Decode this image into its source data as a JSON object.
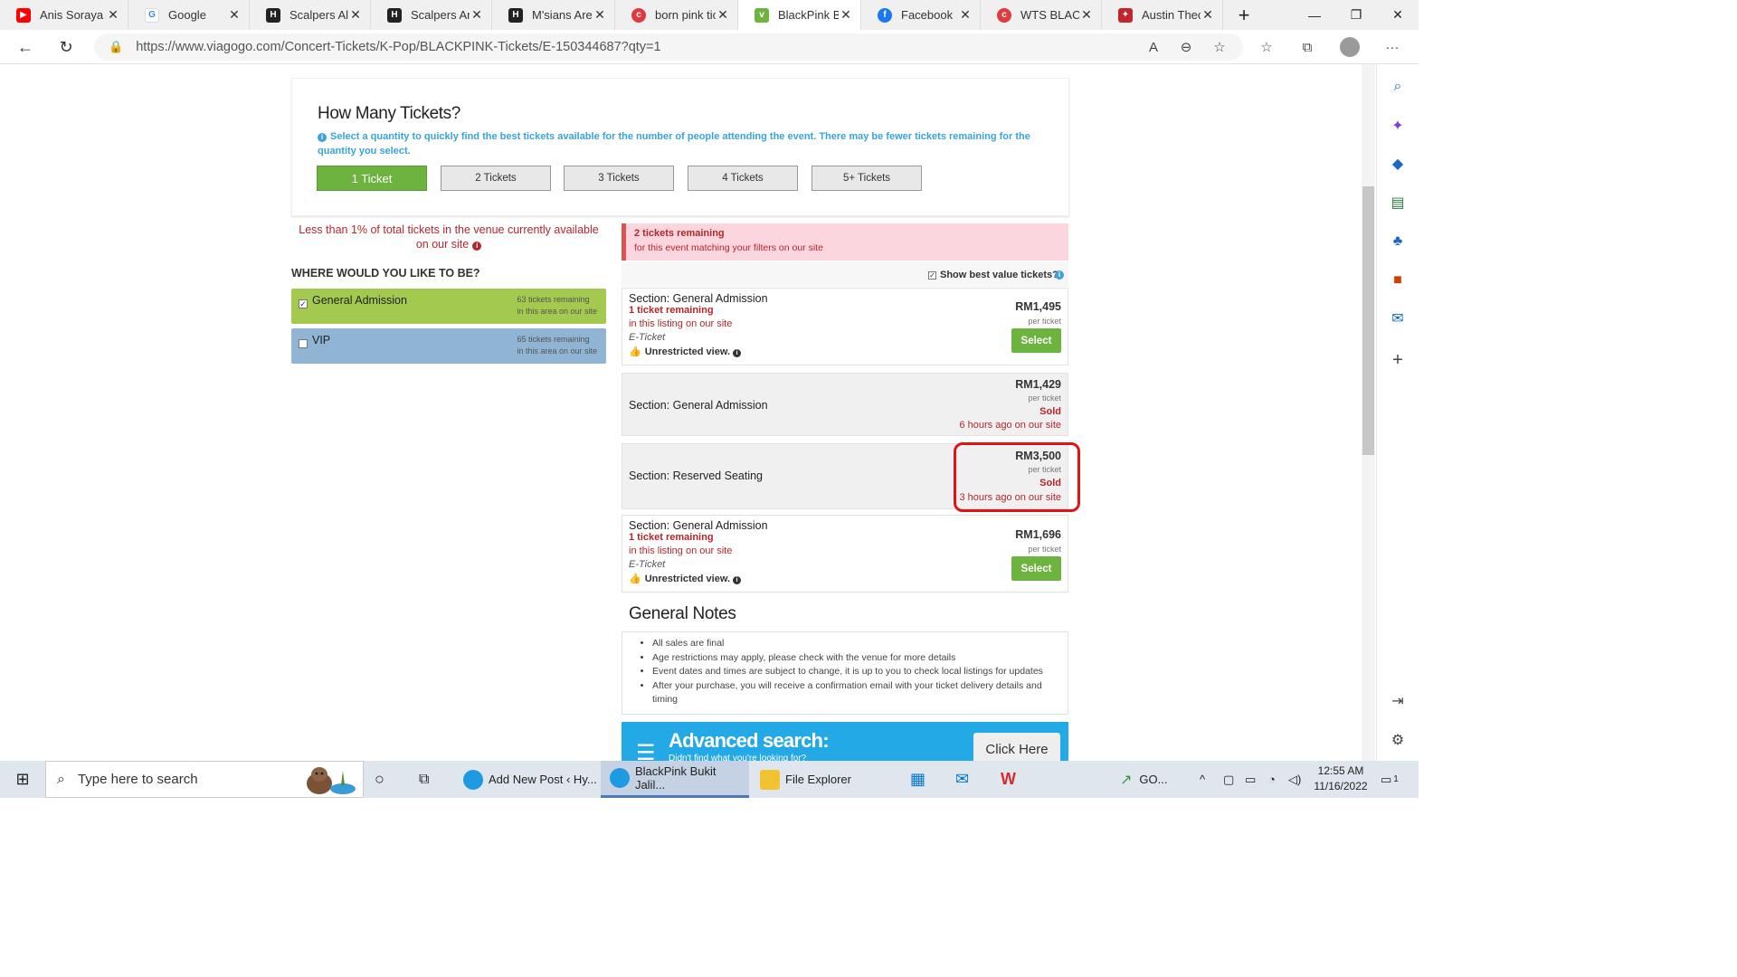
{
  "browser": {
    "tabs": [
      {
        "label": "Anis Soraya",
        "favicon": "youtube-icon",
        "color": "#ff0000"
      },
      {
        "label": "Google",
        "favicon": "google-icon",
        "color": "#4285f4"
      },
      {
        "label": "Scalpers Alre",
        "favicon": "hype-icon",
        "color": "#222222"
      },
      {
        "label": "Scalpers Are",
        "favicon": "hype-icon",
        "color": "#222222"
      },
      {
        "label": "M'sians Are",
        "favicon": "hype-icon",
        "color": "#222222"
      },
      {
        "label": "born pink tic",
        "favicon": "carousell-icon",
        "color": "#e0393e"
      },
      {
        "label": "BlackPink Bu",
        "favicon": "viagogo-icon",
        "color": "#6db33f"
      },
      {
        "label": "Facebook",
        "favicon": "facebook-icon",
        "color": "#1877f2"
      },
      {
        "label": "WTS BLACKP",
        "favicon": "carousell-icon",
        "color": "#e0393e"
      },
      {
        "label": "Austin Theo",
        "favicon": "bird-icon",
        "color": "#c0272d"
      }
    ],
    "url": "https://www.viagogo.com/Concert-Tickets/K-Pop/BLACKPINK-Tickets/E-150344687?qty=1"
  },
  "quantity": {
    "title": "How Many Tickets?",
    "hint": "Select a quantity to quickly find the best tickets available for the number of people attending the event. There may be fewer tickets remaining for the quantity you select.",
    "options": [
      "1 Ticket",
      "2 Tickets",
      "3 Tickets",
      "4 Tickets",
      "5+ Tickets"
    ],
    "selected": "1 Ticket"
  },
  "availability": {
    "line1": "Less than 1% of total tickets in the venue currently available",
    "line2": "on our site"
  },
  "where": {
    "heading": "WHERE WOULD YOU LIKE TO BE?",
    "areas": [
      {
        "name": "General Admission",
        "remaining": "63 tickets remaining",
        "sub": "in this area on our site",
        "checked": "✓",
        "color": "#a4c94f"
      },
      {
        "name": "VIP",
        "remaining": "65 tickets remaining",
        "sub": "in this area on our site",
        "checked": "",
        "color": "#8fb4d4"
      }
    ]
  },
  "remaining_banner": {
    "title": "2 tickets remaining",
    "sub": "for this event matching your filters on our site"
  },
  "best_value_label": "Show best value tickets?",
  "listings": [
    {
      "section": "Section: General Admission",
      "tickets": "1 ticket remaining",
      "in_listing": "in this listing on our site",
      "type": "E-Ticket",
      "view": "Unrestricted view.",
      "price": "RM1,495",
      "per": "per ticket",
      "action": "Select"
    },
    {
      "section": "Section: General Admission",
      "price": "RM1,429",
      "per": "per ticket",
      "status": "Sold",
      "ago": "6 hours ago on our site"
    },
    {
      "section": "Section: Reserved Seating",
      "price": "RM3,500",
      "per": "per ticket",
      "status": "Sold",
      "ago": "3 hours ago on our site"
    },
    {
      "section": "Section: General Admission",
      "tickets": "1 ticket remaining",
      "in_listing": "in this listing on our site",
      "type": "E-Ticket",
      "view": "Unrestricted view.",
      "price": "RM1,696",
      "per": "per ticket",
      "action": "Select"
    }
  ],
  "notes": {
    "title": "General Notes",
    "items": [
      "All sales are final",
      "Age restrictions may apply, please check with the venue for more details",
      "Event dates and times are subject to change, it is up to you to check local listings for updates",
      "After your purchase, you will receive a confirmation email with your ticket delivery details and timing"
    ]
  },
  "advanced": {
    "title": "Advanced search:",
    "sub": "Didn't find what you're looking for?",
    "button": "Click Here"
  },
  "taskbar": {
    "search_placeholder": "Type here to search",
    "apps": [
      {
        "label": "Add New Post ‹ Hy...",
        "icon": "edge-icon"
      },
      {
        "label": "BlackPink Bukit Jalil...",
        "icon": "edge-icon"
      },
      {
        "label": "File Explorer",
        "icon": "folder-icon"
      }
    ],
    "stock": "GO...",
    "time": "12:55 AM",
    "date": "11/16/2022",
    "notif_count": "1"
  },
  "colors": {
    "viagogo_green": "#6db33f",
    "sold_red": "#b3262b",
    "info_blue": "#3aa3d8",
    "highlight_red": "#e01414"
  }
}
